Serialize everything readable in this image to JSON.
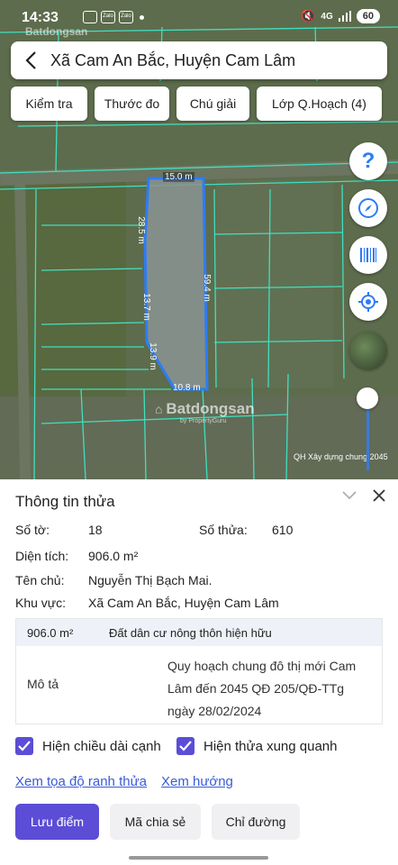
{
  "status_bar": {
    "time": "14:33",
    "app_icons": [
      "zalo-notification",
      "zalo-notification",
      "zalo-notification"
    ],
    "signal": "4G",
    "battery": "60"
  },
  "watermark_top": "Batdongsan",
  "search": {
    "title": "Xã Cam An Bắc, Huyện Cam Lâm"
  },
  "toolbar": {
    "check": "Kiểm tra",
    "measure": "Thước đo",
    "legend": "Chú giải",
    "layer": "Lớp Q.Hoạch (4)"
  },
  "map": {
    "labels": {
      "top": "15.0 m",
      "left_upper": "28.5 m",
      "right": "59.4 m",
      "left_mid": "13.7 m",
      "left_lower": "13.9 m",
      "bottom": "10.8 m"
    },
    "watermark": {
      "name": "Batdongsan",
      "by": "by PropertyGuru"
    },
    "caption": "QH Xây dựng chung 2045",
    "parcel_color": "#2d7cf6"
  },
  "panel": {
    "title": "Thông tin thửa",
    "rows": {
      "so_to": {
        "label": "Số tờ:",
        "value": "18"
      },
      "so_thua": {
        "label": "Số thửa:",
        "value": "610"
      },
      "dien_tich": {
        "label": "Diện tích:",
        "value": "906.0 m²"
      },
      "ten_chu": {
        "label": "Tên chủ:",
        "value": "Nguyễn Thị Bạch Mai."
      },
      "khu_vuc": {
        "label": "Khu vực:",
        "value": "Xã Cam An Bắc, Huyện Cam Lâm"
      }
    },
    "table": {
      "area": "906.0 m²",
      "land_type": "Đất dân cư nông thôn hiện hữu",
      "desc_label": "Mô tả",
      "description": "Quy hoạch chung đô thị mới Cam Lâm đến 2045 QĐ 205/QĐ-TTg ngày 28/02/2024"
    },
    "checkboxes": {
      "edge_length": {
        "label": "Hiện chiều dài cạnh",
        "checked": true
      },
      "neighbors": {
        "label": "Hiện thửa xung quanh",
        "checked": true
      }
    },
    "links": {
      "coords": "Xem tọa độ ranh thửa",
      "direction": "Xem hướng"
    },
    "buttons": {
      "save": "Lưu điểm",
      "share": "Mã chia sẻ",
      "route": "Chỉ đường"
    },
    "accent_color": "#5b4dd6"
  }
}
